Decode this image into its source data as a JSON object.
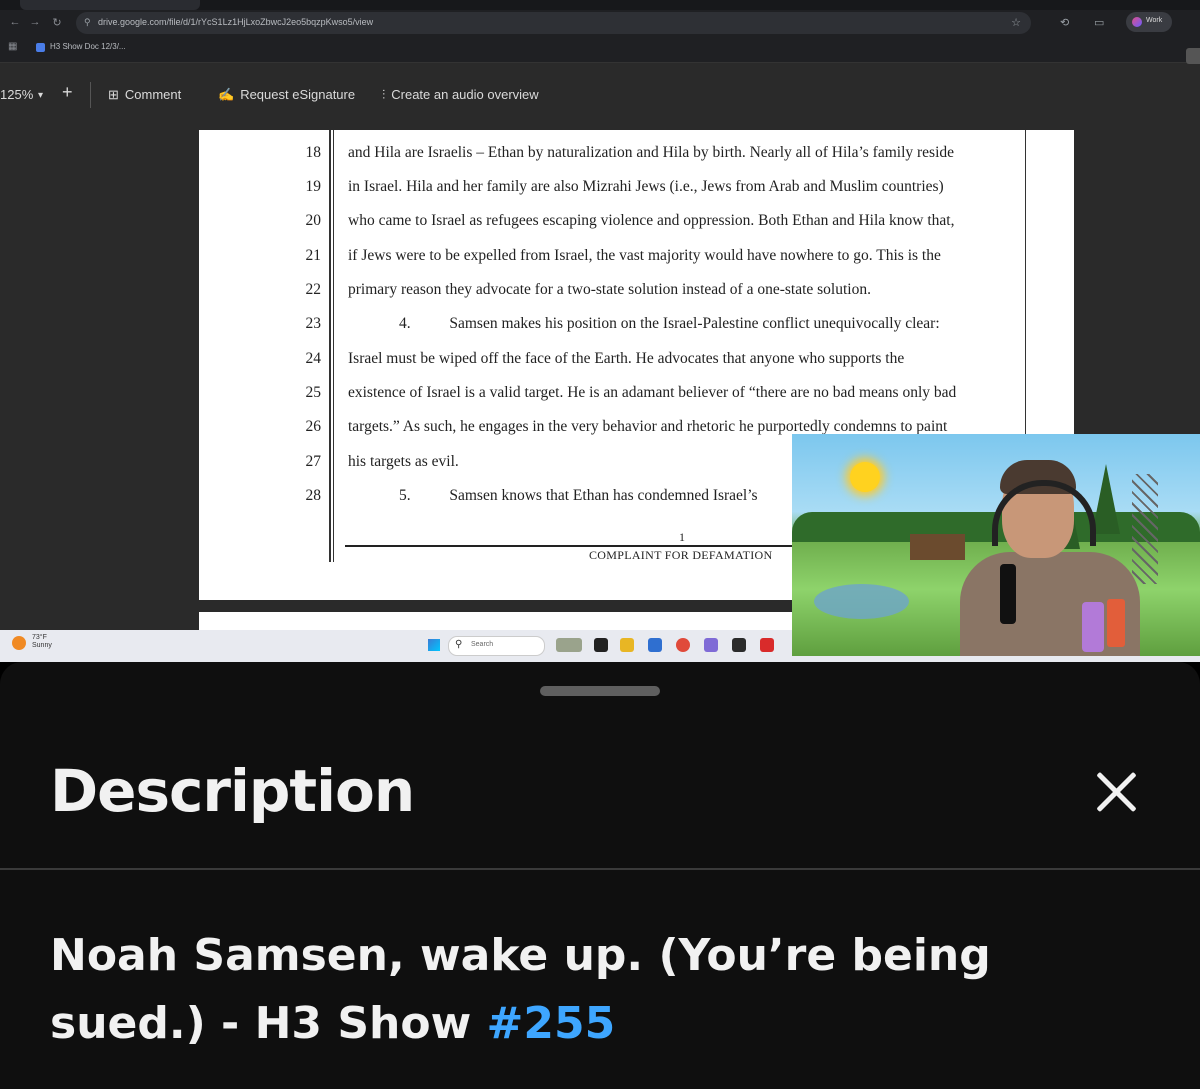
{
  "browser": {
    "url": "drive.google.com/file/d/1/rYcS1Lz1HjLxoZbwcJ2eo5bqzpKwso5/view",
    "bookmark_label": "H3 Show Doc 12/3/...",
    "profile_label": "Work"
  },
  "doc_toolbar": {
    "zoom": "125%",
    "comment": "Comment",
    "esignature": "Request eSignature",
    "audio": "Create an audio overview"
  },
  "document": {
    "lines": [
      {
        "n": "18",
        "text": "and Hila are Israelis – Ethan by naturalization and Hila by birth. Nearly all of Hila’s family reside"
      },
      {
        "n": "19",
        "text": "in Israel. Hila and her family are also Mizrahi Jews (i.e., Jews from Arab and Muslim countries)"
      },
      {
        "n": "20",
        "text": "who came to Israel as refugees escaping violence and oppression. Both Ethan and Hila know that,"
      },
      {
        "n": "21",
        "text": "if Jews were to be expelled from Israel, the vast majority would have nowhere to go. This is the"
      },
      {
        "n": "22",
        "text": "primary reason they advocate for a two-state solution instead of a one-state solution."
      },
      {
        "n": "23",
        "text": "4.          Samsen makes his position on the Israel-Palestine conflict unequivocally clear:"
      },
      {
        "n": "24",
        "text": "Israel must be wiped off the face of the Earth. He advocates that anyone who supports the"
      },
      {
        "n": "25",
        "text": "existence of Israel is a valid target. He is an adamant believer of “there are no bad means only bad"
      },
      {
        "n": "26",
        "text": "targets.” As such, he engages in the very behavior and rhetoric he purportedly condemns to paint"
      },
      {
        "n": "27",
        "text": "his targets as evil."
      },
      {
        "n": "28",
        "text": "5.          Samsen knows that Ethan has condemned Israel’s"
      }
    ],
    "page_number": "1",
    "footer_title": "COMPLAINT FOR DEFAMATION"
  },
  "taskbar": {
    "weather_temp": "73°F",
    "weather_label": "Sunny",
    "search_placeholder": "Search"
  },
  "sheet": {
    "title": "Description",
    "video_title_main": "Noah Samsen, wake up. (You’re being sued.) - H3 Show ",
    "video_title_hashtag": "#255"
  },
  "colors": {
    "hashtag": "#3ea6ff",
    "sheet_bg": "#0f0f0f"
  }
}
